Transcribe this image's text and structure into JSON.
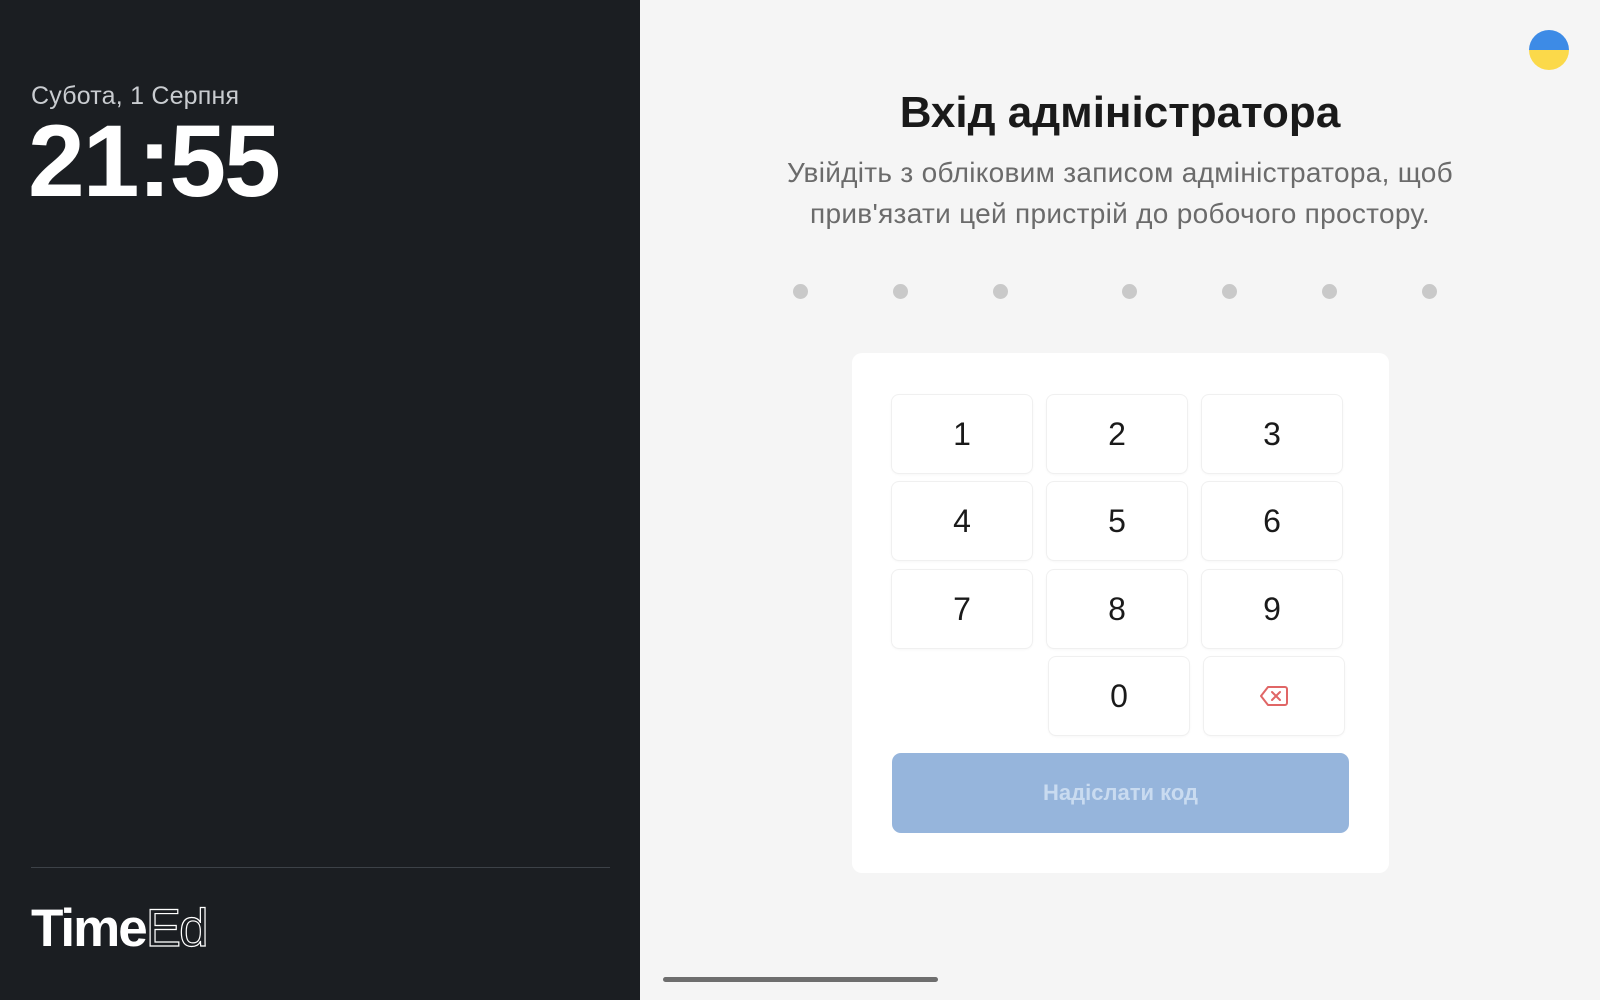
{
  "left_panel": {
    "date": "Субота, 1 Серпня",
    "time": "21:55",
    "brand_primary": "Time",
    "brand_secondary": "Ed"
  },
  "right_panel": {
    "language_flag": "ukraine-flag-icon",
    "title": "Вхід адміністратора",
    "subtitle": "Увійдіть з обліковим записом адміністратора, щоб прив'язати цей пристрій до робочого простору.",
    "pin_length": 7,
    "keypad": {
      "keys": [
        "1",
        "2",
        "3",
        "4",
        "5",
        "6",
        "7",
        "8",
        "9",
        "0"
      ],
      "backspace_icon": "backspace-icon",
      "submit_label": "Надіслати код",
      "submit_enabled": false
    }
  },
  "colors": {
    "left_bg": "#1b1e22",
    "right_bg": "#f5f5f5",
    "submit_disabled_bg": "#96b5dc",
    "backspace_accent": "#e06666",
    "pin_dot_empty": "#c9c9c9"
  }
}
